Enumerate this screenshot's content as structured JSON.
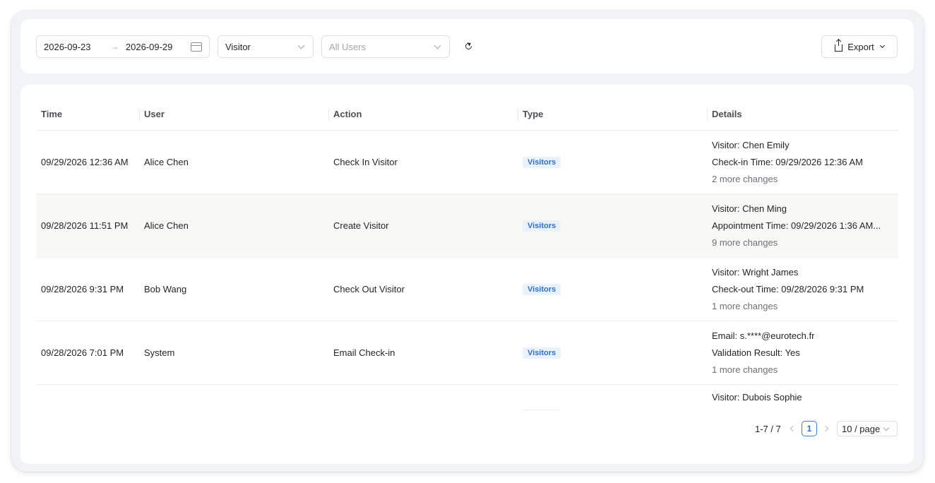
{
  "filters": {
    "date_start": "2026-09-23",
    "date_arrow": "→",
    "date_end": "2026-09-29",
    "type_select": "Visitor",
    "users_placeholder": "All Users",
    "export_label": "Export"
  },
  "table": {
    "columns": [
      "Time",
      "User",
      "Action",
      "Type",
      "Details"
    ],
    "rows": [
      {
        "time": "09/29/2026 12:36 AM",
        "user": "Alice Chen",
        "action": "Check In Visitor",
        "type": "Visitors",
        "details": [
          "Visitor: Chen Emily",
          "Check-in Time: 09/29/2026 12:36 AM"
        ],
        "more": "2 more changes"
      },
      {
        "time": "09/28/2026 11:51 PM",
        "user": "Alice Chen",
        "action": "Create Visitor",
        "type": "Visitors",
        "details": [
          "Visitor: Chen Ming",
          "Appointment Time: 09/29/2026 1:36 AM..."
        ],
        "more": "9 more changes"
      },
      {
        "time": "09/28/2026 9:31 PM",
        "user": "Bob Wang",
        "action": "Check Out Visitor",
        "type": "Visitors",
        "details": [
          "Visitor: Wright James",
          "Check-out Time: 09/28/2026 9:31 PM"
        ],
        "more": "1 more changes"
      },
      {
        "time": "09/28/2026 7:01 PM",
        "user": "System",
        "action": "Email Check-in",
        "type": "Visitors",
        "details": [
          "Email: s.****@eurotech.fr",
          "Validation Result: Yes"
        ],
        "more": "1 more changes"
      },
      {
        "details": [
          "Visitor: Dubois Sophie"
        ]
      }
    ]
  },
  "pagination": {
    "range": "1-7 / 7",
    "current_page": "1",
    "page_size": "10 / page"
  },
  "colors": {
    "badge_bg": "#eaf2fd",
    "badge_text": "#2f6fd6",
    "accent": "#3b7ddd"
  }
}
